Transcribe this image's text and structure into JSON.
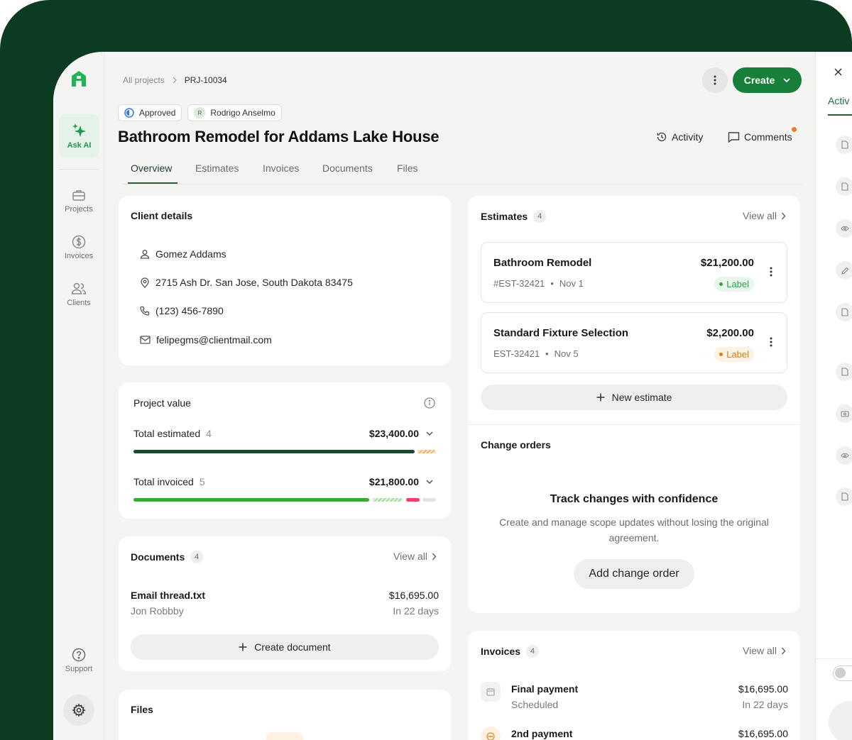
{
  "breadcrumb": {
    "root": "All projects",
    "current": "PRJ-10034"
  },
  "header": {
    "create_label": "Create",
    "status_label": "Approved",
    "assignee_initial": "R",
    "assignee_name": "Rodrigo Anselmo",
    "title": "Bathroom Remodel for Addams Lake House",
    "activity_label": "Activity",
    "comments_label": "Comments"
  },
  "tabs": [
    "Overview",
    "Estimates",
    "Invoices",
    "Documents",
    "Files"
  ],
  "nav": {
    "ask_ai": "Ask AI",
    "items": [
      "Projects",
      "Invoices",
      "Clients"
    ],
    "support": "Support"
  },
  "client": {
    "title": "Client details",
    "name": "Gomez Addams",
    "address": "2715 Ash Dr. San Jose, South Dakota 83475",
    "phone": "(123) 456-7890",
    "email": "felipegms@clientmail.com"
  },
  "project_value": {
    "title": "Project value",
    "estimated_label": "Total estimated",
    "estimated_count": "4",
    "estimated_amount": "$23,400.00",
    "estimated_progress": 0.93,
    "invoiced_label": "Total invoiced",
    "invoiced_count": "5",
    "invoiced_amount": "$21,800.00",
    "invoiced_progress": 0.78
  },
  "documents": {
    "title": "Documents",
    "count": "4",
    "view_all": "View all",
    "items": [
      {
        "name": "Email thread.txt",
        "author": "Jon Robbby",
        "amount": "$16,695.00",
        "due": "In 22 days"
      }
    ],
    "create_label": "Create document"
  },
  "files": {
    "title": "Files"
  },
  "estimates": {
    "title": "Estimates",
    "count": "4",
    "view_all": "View all",
    "items": [
      {
        "name": "Bathroom Remodel",
        "id": "#EST-32421",
        "date": "Nov 1",
        "amount": "$21,200.00",
        "label": "Label",
        "label_color": "#2fa24a",
        "label_bg": "#e9f6ec"
      },
      {
        "name": "Standard Fixture Selection",
        "id": "EST-32421",
        "date": "Nov 5",
        "amount": "$2,200.00",
        "label": "Label",
        "label_color": "#d97c14",
        "label_bg": "#fdf1e2"
      }
    ],
    "new_label": "New estimate"
  },
  "change_orders": {
    "title": "Change orders",
    "heading": "Track changes with confidence",
    "body": "Create and manage scope updates without losing the original agreement.",
    "button": "Add change order"
  },
  "invoices": {
    "title": "Invoices",
    "count": "4",
    "view_all": "View all",
    "items": [
      {
        "name": "Final payment",
        "status": "Scheduled",
        "amount": "$16,695.00",
        "due": "In 22 days"
      },
      {
        "name": "2nd payment",
        "amount": "$16,695.00"
      }
    ]
  },
  "right_panel": {
    "tab_label": "Activ"
  },
  "colors": {
    "brand": "#177f3a",
    "bezel": "#0b3b20",
    "progress_dark": "#1b4a2c",
    "progress_green": "#3aa935",
    "overdue": "#ef3f6b"
  }
}
